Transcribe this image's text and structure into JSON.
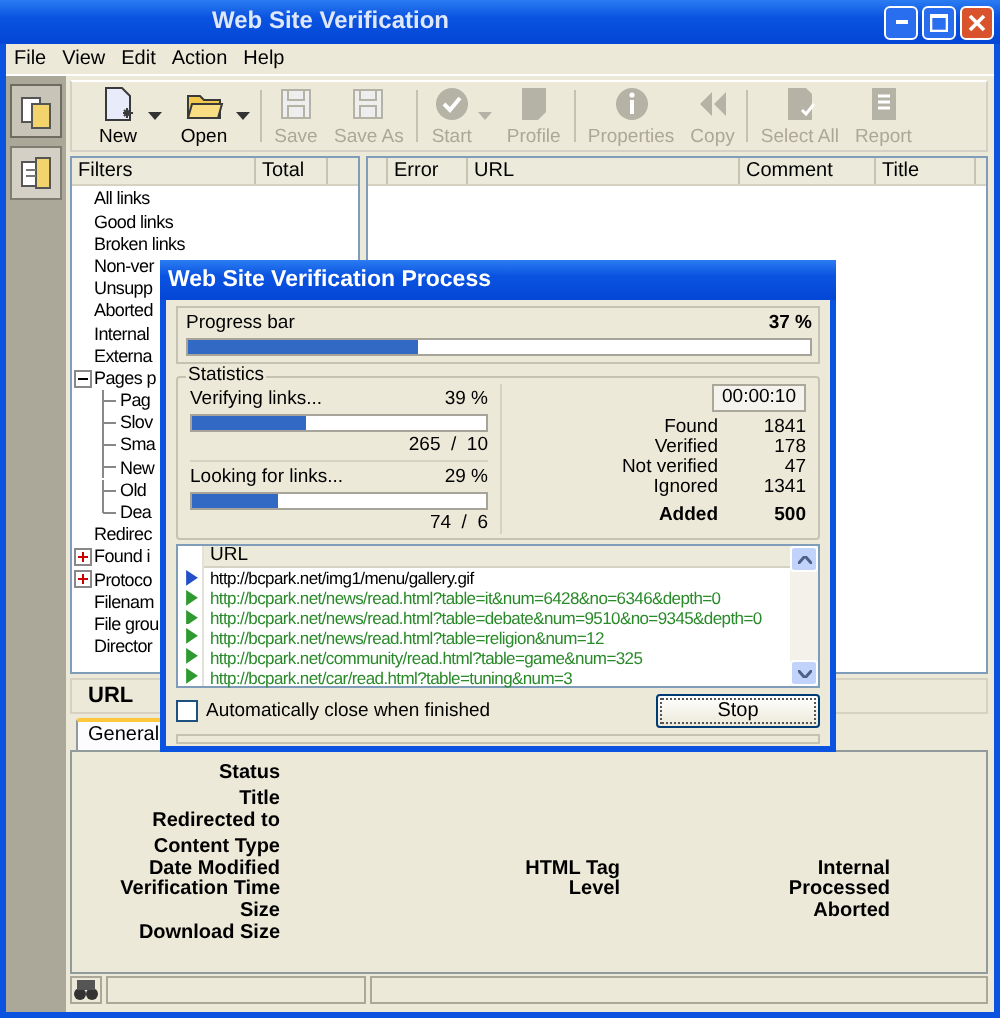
{
  "window": {
    "title": "Web Site Verification"
  },
  "menu": [
    "File",
    "View",
    "Edit",
    "Action",
    "Help"
  ],
  "toolbar": [
    {
      "label": "New",
      "disabled": false,
      "dropdown": true
    },
    {
      "label": "Open",
      "disabled": false,
      "dropdown": true
    },
    {
      "label": "Save",
      "disabled": true,
      "dropdown": false
    },
    {
      "label": "Save As",
      "disabled": true,
      "dropdown": false
    },
    {
      "label": "Start",
      "disabled": true,
      "dropdown": true
    },
    {
      "label": "Profile",
      "disabled": true,
      "dropdown": false
    },
    {
      "label": "Properties",
      "disabled": true,
      "dropdown": false
    },
    {
      "label": "Copy",
      "disabled": true,
      "dropdown": false
    },
    {
      "label": "Select All",
      "disabled": true,
      "dropdown": false
    },
    {
      "label": "Report",
      "disabled": true,
      "dropdown": false
    }
  ],
  "filters": {
    "columns": [
      "Filters",
      "Total"
    ],
    "items": [
      {
        "label": "All links"
      },
      {
        "label": "Good links"
      },
      {
        "label": "Broken links"
      },
      {
        "label": "Non-ver"
      },
      {
        "label": "Unsupp"
      },
      {
        "label": "Aborted"
      },
      {
        "label": "Internal"
      },
      {
        "label": "Externa"
      },
      {
        "label": "Pages p",
        "expanded": true,
        "children": [
          {
            "label": "Pag"
          },
          {
            "label": "Slov"
          },
          {
            "label": "Sma"
          },
          {
            "label": "New"
          },
          {
            "label": "Old"
          },
          {
            "label": "Dea"
          }
        ]
      },
      {
        "label": "Redirec"
      },
      {
        "label": "Found i",
        "expanded": false
      },
      {
        "label": "Protoco",
        "expanded": false
      },
      {
        "label": "Filenam"
      },
      {
        "label": "File grou"
      },
      {
        "label": "Director"
      }
    ]
  },
  "results": {
    "columns": [
      "Error",
      "URL",
      "Comment",
      "Title"
    ]
  },
  "details": {
    "header": "URL",
    "tabs": [
      {
        "label": "General",
        "selected": true
      }
    ],
    "rows": [
      {
        "label": "Status"
      },
      {
        "label": "Title"
      },
      {
        "label": "Redirected to"
      },
      {
        "label": "Content Type"
      },
      {
        "label": "Date Modified",
        "col2": "HTML Tag",
        "col3": "Internal"
      },
      {
        "label": "Verification Time",
        "col2": "Level",
        "col3": "Processed"
      },
      {
        "label": "Size",
        "col3": "Aborted"
      },
      {
        "label": "Download Size"
      }
    ]
  },
  "dialog": {
    "title": "Web Site Verification Process",
    "progress": {
      "label": "Progress bar",
      "reading": "37 %",
      "level": 0.37
    },
    "statistics": {
      "title": "Statistics",
      "tasks": [
        {
          "label": "Verifying links...",
          "reading": "39 %",
          "level": 0.39,
          "counts": "265  /  10"
        },
        {
          "label": "Looking for links...",
          "reading": "29 %",
          "level": 0.29,
          "counts": "74  /  6"
        }
      ],
      "timer": "00:00:10",
      "counters": [
        {
          "label": "Found",
          "value": "1841",
          "kind": "plain"
        },
        {
          "label": "Verified",
          "value": "178",
          "kind": "plain"
        },
        {
          "label": "Not verified",
          "value": "47",
          "kind": "plain"
        },
        {
          "label": "Ignored",
          "value": "1341",
          "kind": "plain"
        },
        {
          "label": "Added",
          "value": "500",
          "kind": "total"
        }
      ]
    },
    "url_list": {
      "column": "URL",
      "rows": [
        {
          "url": "http://bcpark.net/img1/menu/gallery.gif",
          "kind": "current"
        },
        {
          "url": "http://bcpark.net/news/read.html?table=it&num=6428&no=6346&depth=0",
          "kind": "done"
        },
        {
          "url": "http://bcpark.net/news/read.html?table=debate&num=9510&no=9345&depth=0",
          "kind": "done"
        },
        {
          "url": "http://bcpark.net/news/read.html?table=religion&num=12",
          "kind": "done"
        },
        {
          "url": "http://bcpark.net/community/read.html?table=game&num=325",
          "kind": "done"
        },
        {
          "url": "http://bcpark.net/car/read.html?table=tuning&num=3",
          "kind": "done"
        }
      ]
    },
    "auto_close": {
      "label": "Automatically close when finished",
      "checked": false
    },
    "stop_button": "Stop"
  }
}
